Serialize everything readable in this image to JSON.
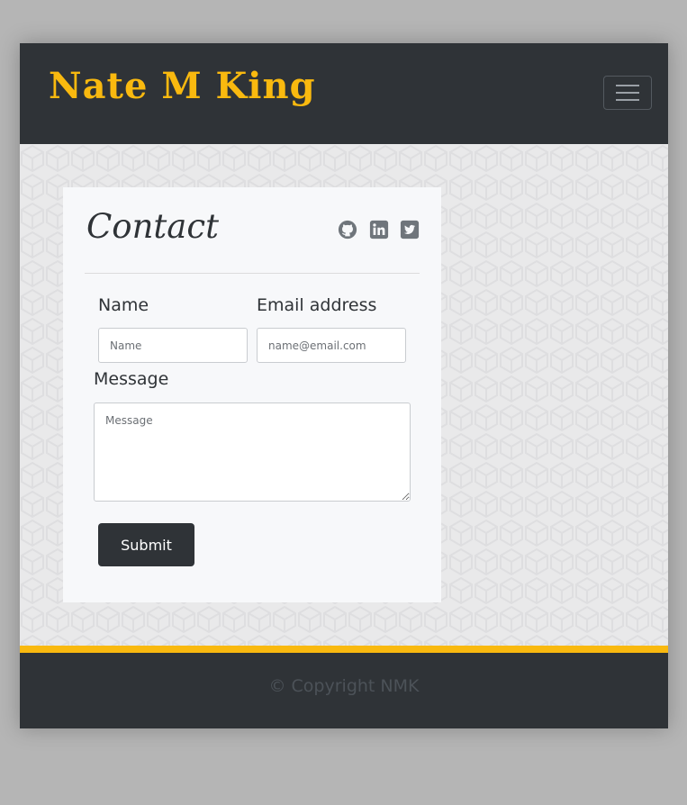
{
  "header": {
    "brand": "Nate M King",
    "brand_color": "#f9b90f",
    "menu_toggle_icon": "hamburger-icon"
  },
  "contact": {
    "title": "Contact",
    "social_icons": [
      "github-icon",
      "linkedin-icon",
      "twitter-icon"
    ],
    "social_icon_color": "#6f757b",
    "name_label": "Name",
    "name_placeholder": "Name",
    "email_label": "Email address",
    "email_placeholder": "name@email.com",
    "message_label": "Message",
    "message_placeholder": "Message",
    "submit_label": "Submit"
  },
  "footer": {
    "copyright": "© Copyright NMK",
    "accent_color": "#f9b90f",
    "background_color": "#2f3337"
  }
}
